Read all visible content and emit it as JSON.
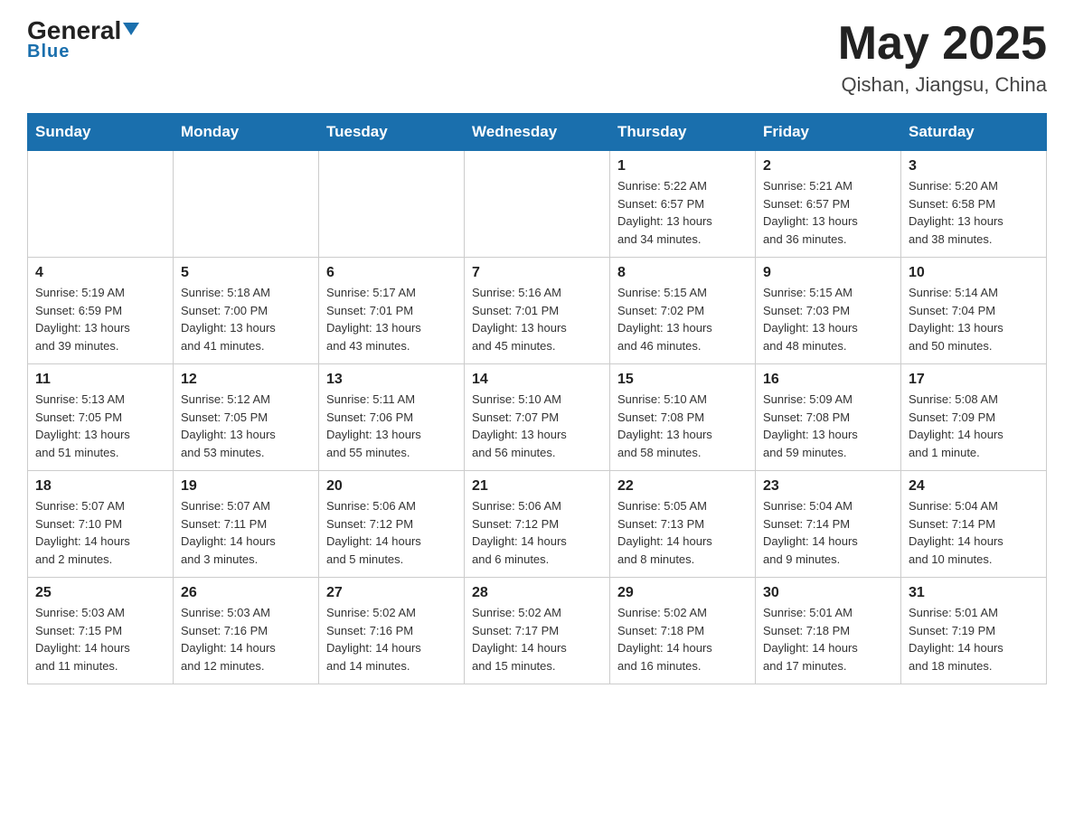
{
  "header": {
    "logo_general": "General",
    "logo_blue": "Blue",
    "month_title": "May 2025",
    "location": "Qishan, Jiangsu, China"
  },
  "weekdays": [
    "Sunday",
    "Monday",
    "Tuesday",
    "Wednesday",
    "Thursday",
    "Friday",
    "Saturday"
  ],
  "weeks": [
    [
      {
        "day": "",
        "info": ""
      },
      {
        "day": "",
        "info": ""
      },
      {
        "day": "",
        "info": ""
      },
      {
        "day": "",
        "info": ""
      },
      {
        "day": "1",
        "info": "Sunrise: 5:22 AM\nSunset: 6:57 PM\nDaylight: 13 hours\nand 34 minutes."
      },
      {
        "day": "2",
        "info": "Sunrise: 5:21 AM\nSunset: 6:57 PM\nDaylight: 13 hours\nand 36 minutes."
      },
      {
        "day": "3",
        "info": "Sunrise: 5:20 AM\nSunset: 6:58 PM\nDaylight: 13 hours\nand 38 minutes."
      }
    ],
    [
      {
        "day": "4",
        "info": "Sunrise: 5:19 AM\nSunset: 6:59 PM\nDaylight: 13 hours\nand 39 minutes."
      },
      {
        "day": "5",
        "info": "Sunrise: 5:18 AM\nSunset: 7:00 PM\nDaylight: 13 hours\nand 41 minutes."
      },
      {
        "day": "6",
        "info": "Sunrise: 5:17 AM\nSunset: 7:01 PM\nDaylight: 13 hours\nand 43 minutes."
      },
      {
        "day": "7",
        "info": "Sunrise: 5:16 AM\nSunset: 7:01 PM\nDaylight: 13 hours\nand 45 minutes."
      },
      {
        "day": "8",
        "info": "Sunrise: 5:15 AM\nSunset: 7:02 PM\nDaylight: 13 hours\nand 46 minutes."
      },
      {
        "day": "9",
        "info": "Sunrise: 5:15 AM\nSunset: 7:03 PM\nDaylight: 13 hours\nand 48 minutes."
      },
      {
        "day": "10",
        "info": "Sunrise: 5:14 AM\nSunset: 7:04 PM\nDaylight: 13 hours\nand 50 minutes."
      }
    ],
    [
      {
        "day": "11",
        "info": "Sunrise: 5:13 AM\nSunset: 7:05 PM\nDaylight: 13 hours\nand 51 minutes."
      },
      {
        "day": "12",
        "info": "Sunrise: 5:12 AM\nSunset: 7:05 PM\nDaylight: 13 hours\nand 53 minutes."
      },
      {
        "day": "13",
        "info": "Sunrise: 5:11 AM\nSunset: 7:06 PM\nDaylight: 13 hours\nand 55 minutes."
      },
      {
        "day": "14",
        "info": "Sunrise: 5:10 AM\nSunset: 7:07 PM\nDaylight: 13 hours\nand 56 minutes."
      },
      {
        "day": "15",
        "info": "Sunrise: 5:10 AM\nSunset: 7:08 PM\nDaylight: 13 hours\nand 58 minutes."
      },
      {
        "day": "16",
        "info": "Sunrise: 5:09 AM\nSunset: 7:08 PM\nDaylight: 13 hours\nand 59 minutes."
      },
      {
        "day": "17",
        "info": "Sunrise: 5:08 AM\nSunset: 7:09 PM\nDaylight: 14 hours\nand 1 minute."
      }
    ],
    [
      {
        "day": "18",
        "info": "Sunrise: 5:07 AM\nSunset: 7:10 PM\nDaylight: 14 hours\nand 2 minutes."
      },
      {
        "day": "19",
        "info": "Sunrise: 5:07 AM\nSunset: 7:11 PM\nDaylight: 14 hours\nand 3 minutes."
      },
      {
        "day": "20",
        "info": "Sunrise: 5:06 AM\nSunset: 7:12 PM\nDaylight: 14 hours\nand 5 minutes."
      },
      {
        "day": "21",
        "info": "Sunrise: 5:06 AM\nSunset: 7:12 PM\nDaylight: 14 hours\nand 6 minutes."
      },
      {
        "day": "22",
        "info": "Sunrise: 5:05 AM\nSunset: 7:13 PM\nDaylight: 14 hours\nand 8 minutes."
      },
      {
        "day": "23",
        "info": "Sunrise: 5:04 AM\nSunset: 7:14 PM\nDaylight: 14 hours\nand 9 minutes."
      },
      {
        "day": "24",
        "info": "Sunrise: 5:04 AM\nSunset: 7:14 PM\nDaylight: 14 hours\nand 10 minutes."
      }
    ],
    [
      {
        "day": "25",
        "info": "Sunrise: 5:03 AM\nSunset: 7:15 PM\nDaylight: 14 hours\nand 11 minutes."
      },
      {
        "day": "26",
        "info": "Sunrise: 5:03 AM\nSunset: 7:16 PM\nDaylight: 14 hours\nand 12 minutes."
      },
      {
        "day": "27",
        "info": "Sunrise: 5:02 AM\nSunset: 7:16 PM\nDaylight: 14 hours\nand 14 minutes."
      },
      {
        "day": "28",
        "info": "Sunrise: 5:02 AM\nSunset: 7:17 PM\nDaylight: 14 hours\nand 15 minutes."
      },
      {
        "day": "29",
        "info": "Sunrise: 5:02 AM\nSunset: 7:18 PM\nDaylight: 14 hours\nand 16 minutes."
      },
      {
        "day": "30",
        "info": "Sunrise: 5:01 AM\nSunset: 7:18 PM\nDaylight: 14 hours\nand 17 minutes."
      },
      {
        "day": "31",
        "info": "Sunrise: 5:01 AM\nSunset: 7:19 PM\nDaylight: 14 hours\nand 18 minutes."
      }
    ]
  ]
}
